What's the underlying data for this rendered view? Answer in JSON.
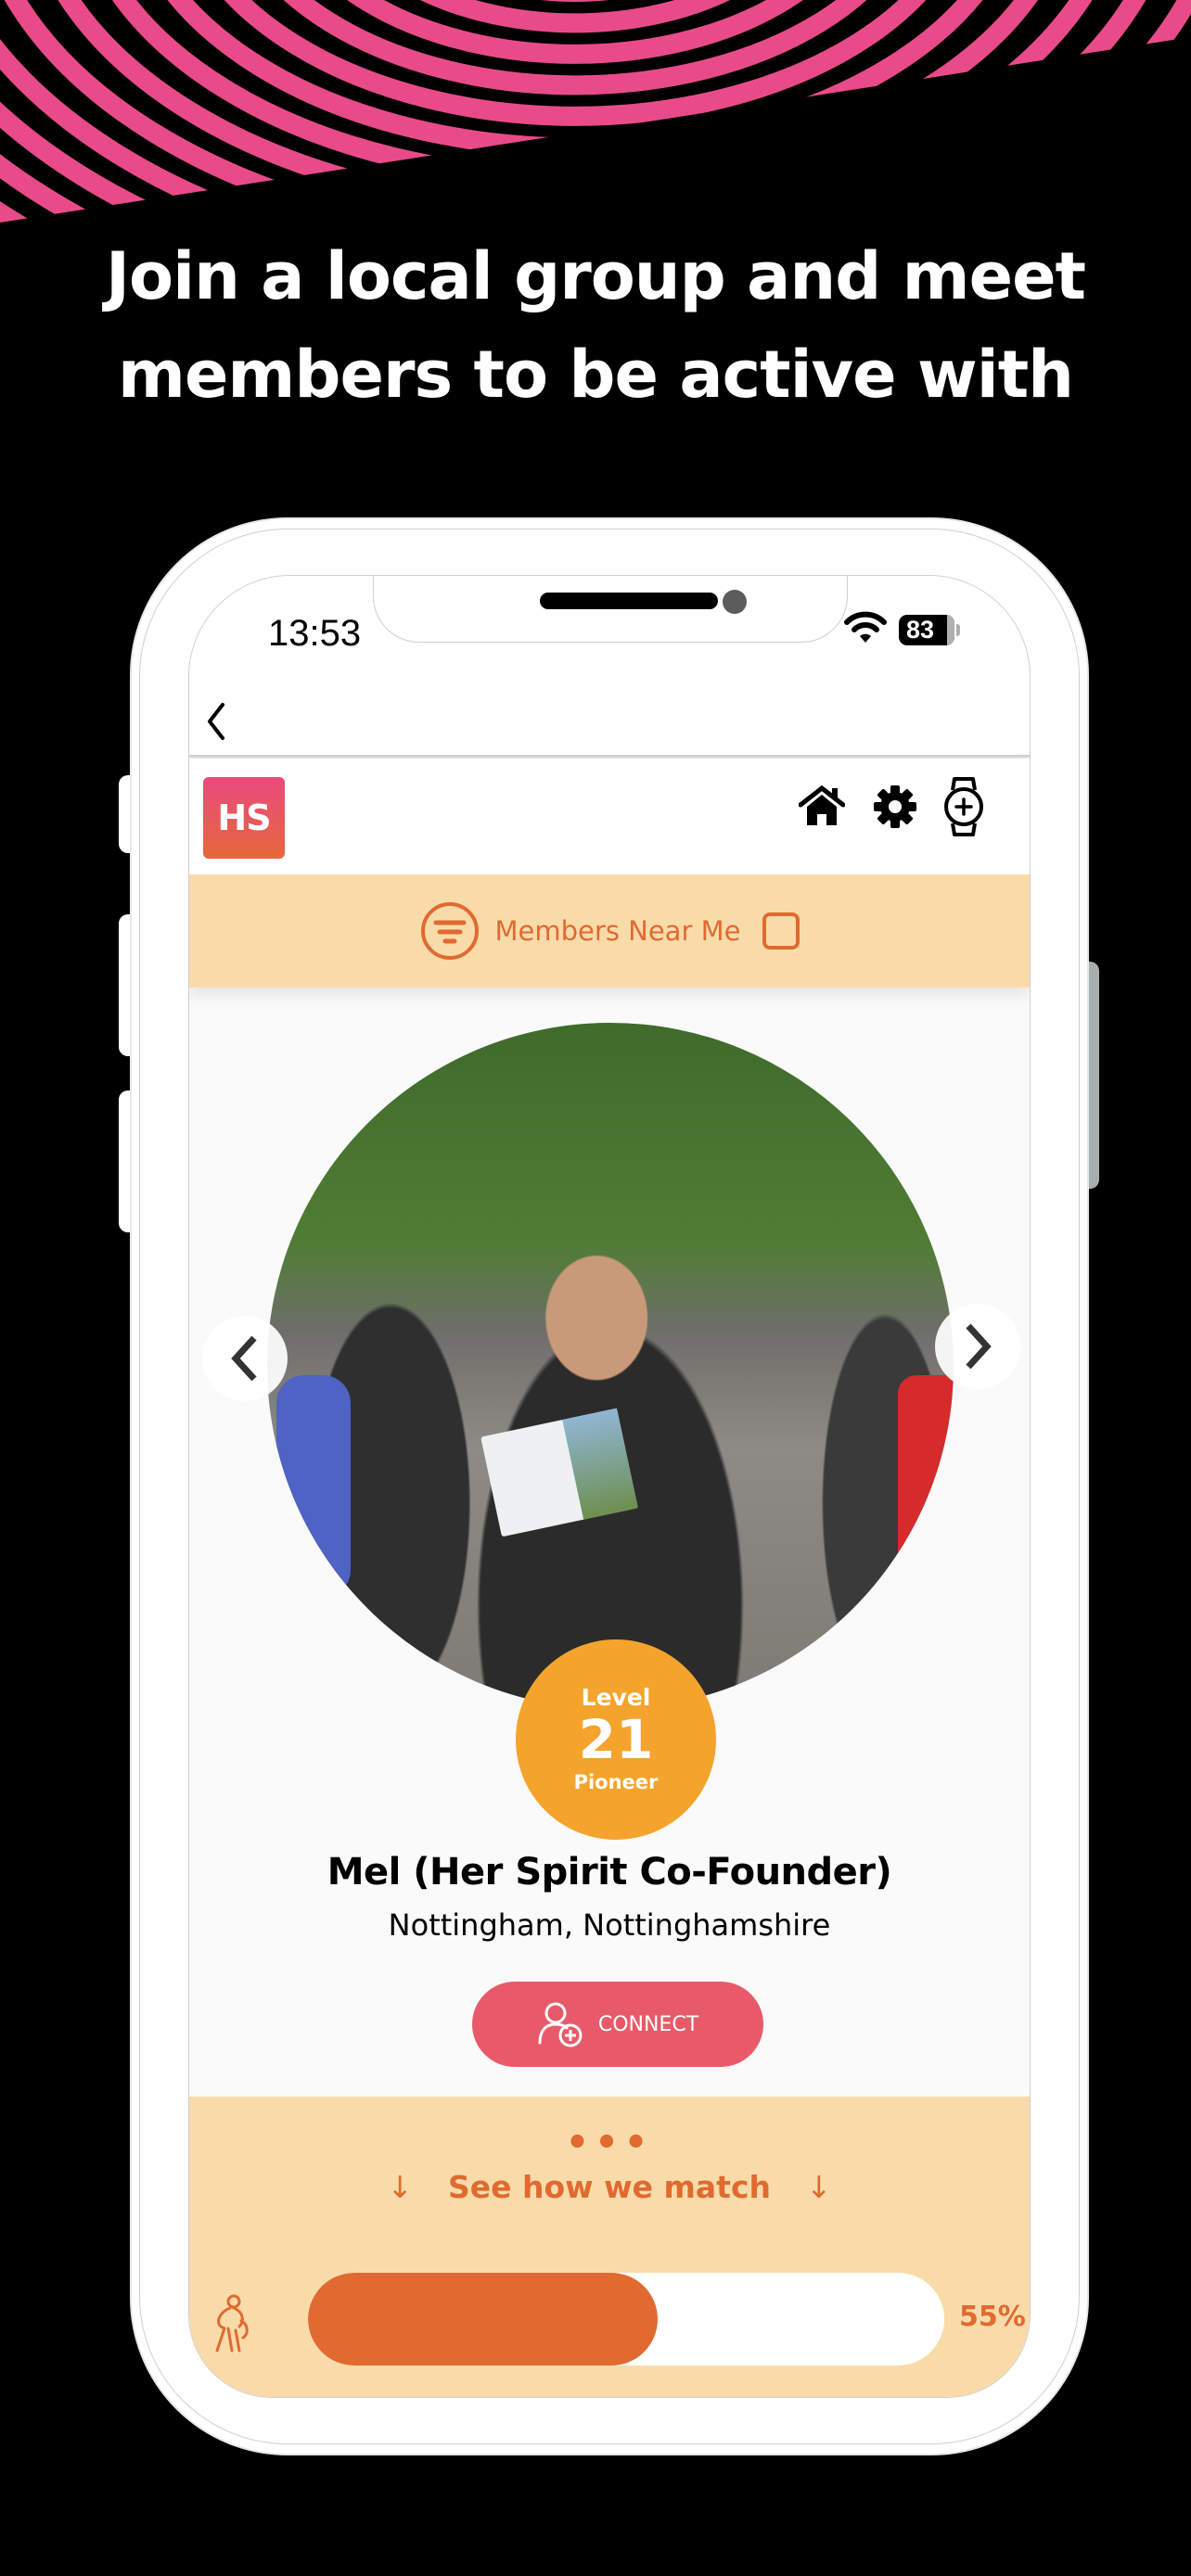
{
  "headline": {
    "line1": "Join a local group and meet",
    "line2": "members to be active with"
  },
  "colors": {
    "accent_pink": "#e94b8a",
    "accent_orange": "#e06a2f",
    "filter_bg": "#f9dbaa",
    "level_badge": "#f4a42c",
    "connect_button": "#e85a6a"
  },
  "status_bar": {
    "time": "13:53",
    "battery": "83",
    "wifi_icon": "wifi-icon"
  },
  "nav": {
    "back_icon": "chevron-left-icon"
  },
  "app_header": {
    "logo_text": "HS",
    "icons": [
      "home-icon",
      "gear-icon",
      "watch-add-icon"
    ]
  },
  "filter": {
    "label": "Members Near Me",
    "icon": "filter-icon",
    "checked": false
  },
  "profile": {
    "level_label": "Level",
    "level_number": "21",
    "level_title": "Pioneer",
    "name": "Mel (Her Spirit Co-Founder)",
    "location": "Nottingham, Nottinghamshire",
    "connect_label": "CONNECT",
    "photo_alt": "Group of open-water swimmers in wetsuits; woman holding a Chillswim certificate"
  },
  "match": {
    "dots": "•••",
    "label": "See how we match",
    "arrow": "↓",
    "rows": [
      {
        "icon": "walking-icon",
        "percent": 55,
        "percent_label": "55%"
      }
    ]
  }
}
